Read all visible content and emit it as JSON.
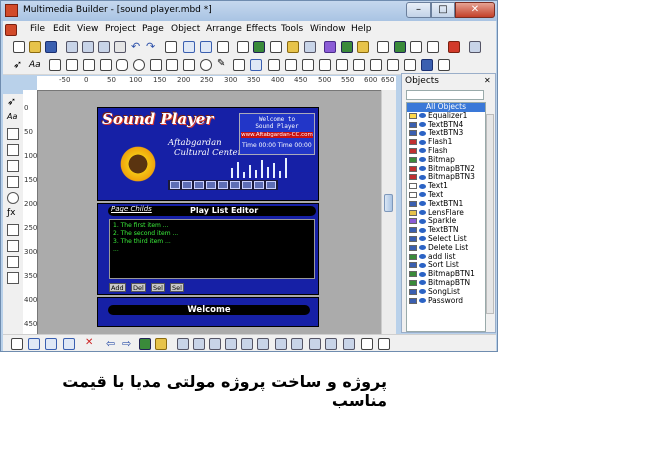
{
  "window": {
    "title": "Multimedia Builder - [sound player.mbd *]"
  },
  "menu": [
    "File",
    "Edit",
    "View",
    "Project",
    "Page",
    "Object",
    "Arrange",
    "Effects",
    "Tools",
    "Window",
    "Help"
  ],
  "ruler": {
    "top_ticks": [
      "-50",
      "0",
      "50",
      "100",
      "150",
      "200",
      "250",
      "300",
      "350",
      "400",
      "450",
      "500",
      "550",
      "600",
      "650"
    ],
    "left_ticks": [
      "0",
      "50",
      "100",
      "150",
      "200",
      "250",
      "300",
      "350",
      "400",
      "450"
    ]
  },
  "sound_player": {
    "title": "Sound Player",
    "sub1": "Aftabgardan",
    "sub2": "Cultural Center",
    "lcd_line1": "Welcome to",
    "lcd_line2": "Sound Player",
    "lcd_url": "www.Aftabgardan-CC.com",
    "lcd_time": "Time 00:00  Time 00:00"
  },
  "playlist": {
    "tab": "Page Childs",
    "title": "Play List Editor",
    "items": [
      "1. The first item ...",
      "2. The second item ...",
      "3. The third item ...",
      "..."
    ],
    "buttons": [
      "Add",
      "Del",
      "Sel",
      "Sel"
    ]
  },
  "welcome": {
    "text": "Welcome"
  },
  "objects_panel": {
    "title": "Objects",
    "header": "All Objects",
    "items": [
      "Equalizer1",
      "TextBTN4",
      "TextBTN3",
      "Flash1",
      "Flash",
      "Bitmap",
      "BitmapBTN2",
      "BitmapBTN3",
      "Text1",
      "Text",
      "TextBTN1",
      "LensFlare",
      "Sparkle",
      "TextBTN",
      "Select List",
      "Delete List",
      "add list",
      "Sort List",
      "BitmapBTN1",
      "BitmapBTN",
      "SongList",
      "Password"
    ]
  },
  "caption": "پروژه و ساخت پروژه مولتی مدیا با قیمت مناسب"
}
